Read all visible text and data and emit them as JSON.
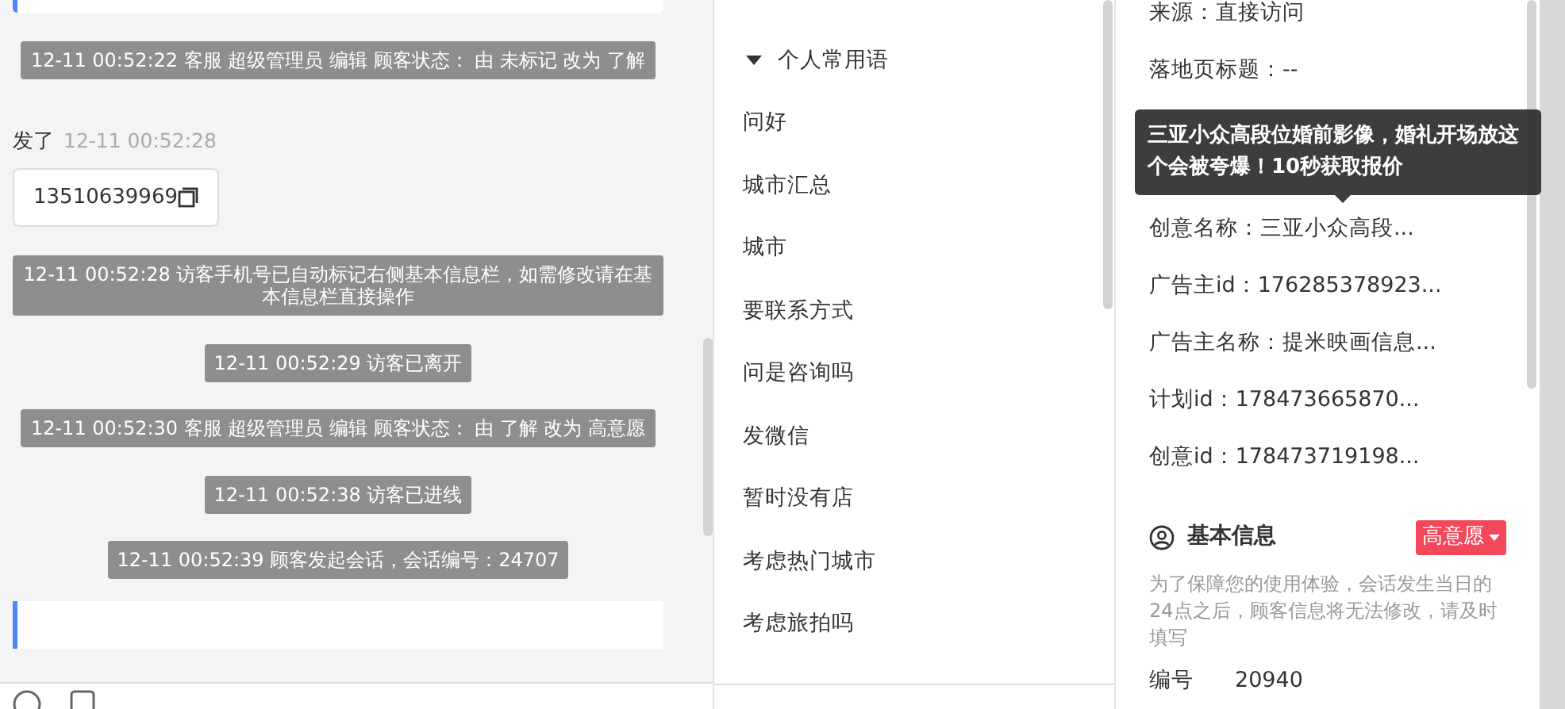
{
  "chat": {
    "messages": [
      {
        "kind": "notice",
        "text": "12-11 00:52:22 客服 超级管理员 编辑 顾客状态： 由 未标记 改为 了解"
      },
      {
        "kind": "visitor",
        "sender": "发了",
        "time": "12-11 00:52:28",
        "text": "13510639969"
      },
      {
        "kind": "notice",
        "text": "12-11 00:52:28 访客手机号已自动标记右侧基本信息栏，如需修改请在基本信息栏直接操作"
      },
      {
        "kind": "notice",
        "text": "12-11 00:52:29 访客已离开"
      },
      {
        "kind": "notice",
        "text": "12-11 00:52:30 客服 超级管理员 编辑 顾客状态： 由 了解 改为 高意愿"
      },
      {
        "kind": "notice",
        "text": "12-11 00:52:38 访客已进线"
      },
      {
        "kind": "notice",
        "text": "12-11 00:52:39 顾客发起会话，会话编号：24707"
      }
    ]
  },
  "phrases": {
    "group": {
      "label": "个人常用语",
      "expanded": true
    },
    "items": [
      "问好",
      "城市汇总",
      "城市",
      "要联系方式",
      "问是咨询吗",
      "发微信",
      "暂时没有店",
      "考虑热门城市",
      "考虑旅拍吗"
    ]
  },
  "visitor_info": {
    "rows": [
      {
        "label": "来源：",
        "value": "直接访问"
      },
      {
        "label": "落地页标题：",
        "value": "--"
      },
      {
        "kind": "tooltip",
        "text": "三亚小众高段位婚前影像，婚礼开场放这个会被夸爆！10秒获取报价"
      },
      {
        "label": "创意名称：",
        "value": "三亚小众高段..."
      },
      {
        "label": "广告主id：",
        "value": "176285378923..."
      },
      {
        "label": "广告主名称：",
        "value": "提米映画信息..."
      },
      {
        "label": "计划id：",
        "value": "178473665870..."
      },
      {
        "label": "创意id：",
        "value": "178473719198..."
      }
    ]
  },
  "basic_info": {
    "title": "基本信息",
    "status": {
      "label": "高意愿",
      "color": "#f5475a"
    },
    "note": "为了保障您的使用体验，会话发生当日的24点之后，顾客信息将无法修改，请及时填写",
    "fields": [
      {
        "label": "编号",
        "value": "20940"
      }
    ]
  }
}
